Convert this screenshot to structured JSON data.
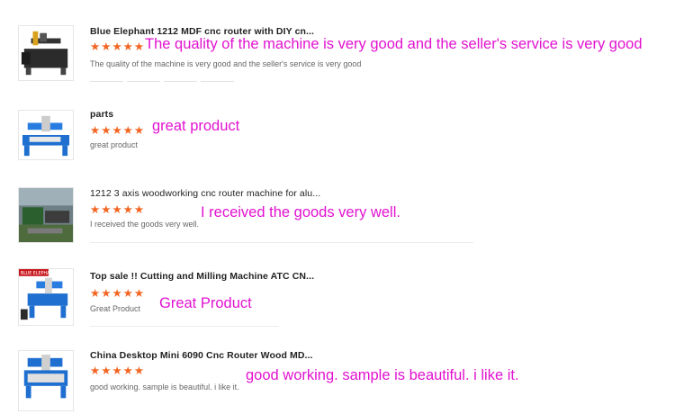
{
  "reviews": [
    {
      "title": "Blue Elephant 1212 MDF cnc router with DIY cn...",
      "rating": 5,
      "comment": "The quality of the machine is very good and the seller's service is very good",
      "text": "The quality of the machine is very good and the seller's service is very good",
      "icon": "cnc-machine-thumbnail"
    },
    {
      "title": "parts",
      "rating": 5,
      "comment": "great product",
      "text": "great product",
      "icon": "cnc-router-thumbnail"
    },
    {
      "title": "1212 3 axis woodworking cnc router machine for alu...",
      "rating": 5,
      "comment": "I received the goods very well.",
      "text": "I received the goods very well.",
      "icon": "factory-photo-thumbnail"
    },
    {
      "title": "Top sale !! Cutting and Milling Machine ATC CN...",
      "rating": 5,
      "comment": "Great Product",
      "text": "Great Product",
      "icon": "blue-elephant-machine-thumbnail",
      "logo_text": "BLUE ELEPHANT"
    },
    {
      "title": "China Desktop Mini 6090 Cnc Router Wood MD...",
      "rating": 5,
      "comment": "good working. sample is beautiful. i like it.",
      "text": "good working. sample is beautiful. i like it.",
      "icon": "desktop-cnc-thumbnail"
    }
  ],
  "colors": {
    "star": "#f26522",
    "comment": "#e112d0",
    "machine_blue": "#1e6fd0"
  }
}
